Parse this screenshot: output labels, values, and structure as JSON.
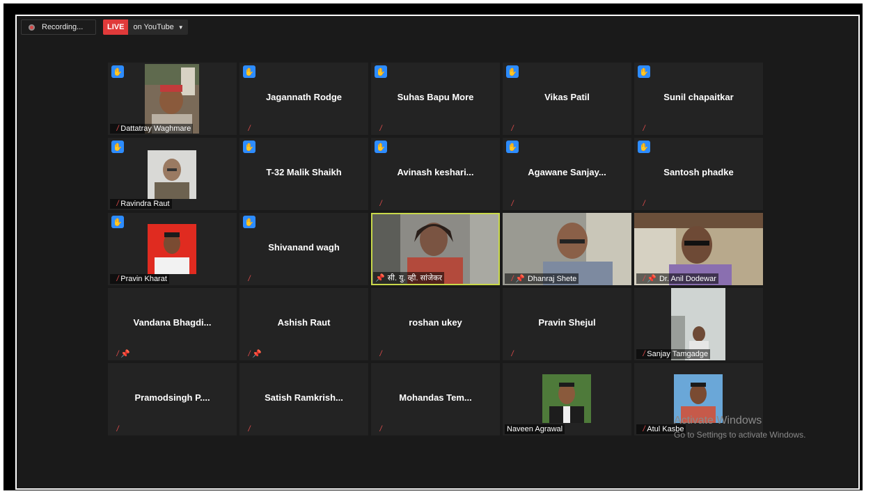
{
  "topbar": {
    "recording_label": "Recording...",
    "live_label": "LIVE",
    "youtube_label": "on YouTube"
  },
  "participants": [
    {
      "name": "Dattatray Waghmare"
    },
    {
      "name": "Jagannath Rodge"
    },
    {
      "name": "Suhas Bapu More"
    },
    {
      "name": "Vikas Patil"
    },
    {
      "name": "Sunil chapaitkar"
    },
    {
      "name": "Ravindra Raut"
    },
    {
      "name": "T-32 Malik Shaikh"
    },
    {
      "name": "Avinash  keshari..."
    },
    {
      "name": "Agawane  Sanjay..."
    },
    {
      "name": "Santosh phadke"
    },
    {
      "name": "Pravin Kharat"
    },
    {
      "name": "Shivanand wagh"
    },
    {
      "name": "सी. यु. व्ही. सांजेकर"
    },
    {
      "name": "Dhanraj Shete"
    },
    {
      "name": "Dr. Anil Dodewar"
    },
    {
      "name": "Vandana  Bhagdi..."
    },
    {
      "name": "Ashish Raut"
    },
    {
      "name": "roshan ukey"
    },
    {
      "name": "Pravin Shejul"
    },
    {
      "name": "Sanjay Tamgadge"
    },
    {
      "name": "Pramodsingh  P...."
    },
    {
      "name": "Satish  Ramkrish..."
    },
    {
      "name": "Mohandas  Tem..."
    },
    {
      "name": "Naveen Agrawal"
    },
    {
      "name": "Atul Kasbe"
    }
  ],
  "watermark": {
    "line1": "Activate Windows",
    "line2": "Go to Settings to activate Windows."
  },
  "icons": {
    "hand": "raise-hand-icon",
    "mute": "muted-mic-icon",
    "pin": "pin-icon",
    "rec": "record-dot-icon"
  },
  "colors": {
    "accent_blue": "#2d8cff",
    "live_red": "#e03a3a",
    "active_speaker": "#c9d94a",
    "tile_bg": "#232323"
  }
}
